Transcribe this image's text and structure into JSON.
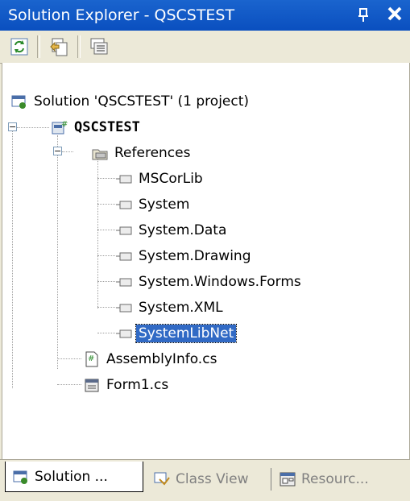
{
  "window": {
    "title": "Solution Explorer - QSCSTEST",
    "pin_glyph": "1",
    "close_glyph": "✕"
  },
  "toolbar": {
    "buttons": [
      {
        "name": "refresh-icon"
      },
      {
        "name": "show-all-files-icon"
      },
      {
        "name": "properties-icon"
      }
    ]
  },
  "tree": {
    "solution": "Solution 'QSCSTEST' (1 project)",
    "project": "QSCSTEST",
    "references_folder": "References",
    "references": [
      "MSCorLib",
      "System",
      "System.Data",
      "System.Drawing",
      "System.Windows.Forms",
      "System.XML",
      "SystemLibNet"
    ],
    "files": [
      "AssemblyInfo.cs",
      "Form1.cs"
    ],
    "selected": "SystemLibNet"
  },
  "tabs": [
    {
      "label": "Solution ...",
      "active": true
    },
    {
      "label": "Class View",
      "active": false
    },
    {
      "label": "Resourc...",
      "active": false
    }
  ],
  "colors": {
    "title_bar": "#0a4fbf",
    "selection": "#316ac5"
  }
}
